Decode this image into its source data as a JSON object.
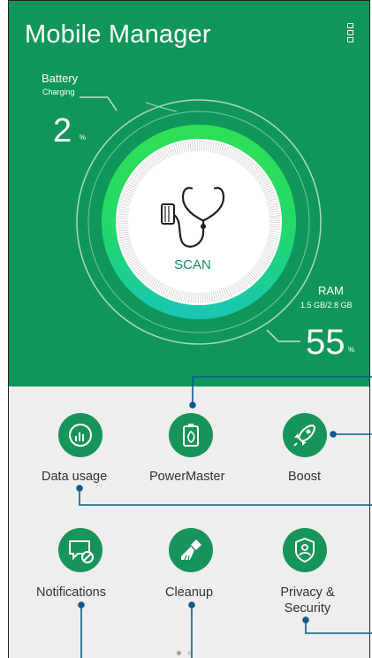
{
  "app": {
    "title": "Mobile Manager"
  },
  "battery": {
    "label": "Battery",
    "status": "Charging",
    "value": "2",
    "unit": "%"
  },
  "ram": {
    "label": "RAM",
    "detail": "1.5 GB/2.8 GB",
    "value": "55",
    "unit": "%"
  },
  "scan": {
    "label": "SCAN"
  },
  "tiles": [
    {
      "label": "Data usage",
      "icon": "data-usage-icon"
    },
    {
      "label": "PowerMaster",
      "icon": "power-master-icon"
    },
    {
      "label": "Boost",
      "icon": "rocket-icon"
    },
    {
      "label": "Notifications",
      "icon": "notification-blocked-icon"
    },
    {
      "label": "Cleanup",
      "icon": "brush-icon"
    },
    {
      "label": "Privacy &",
      "label2": "Security",
      "icon": "shield-icon"
    }
  ],
  "pager": {
    "active_color": "#9e9e9e",
    "inactive_color": "#d0d0d0"
  },
  "colors": {
    "header_green": "#10965a",
    "icon_green": "#17945a",
    "background_gray": "#eeeeee",
    "callout_blue": "#0d5a8c"
  }
}
